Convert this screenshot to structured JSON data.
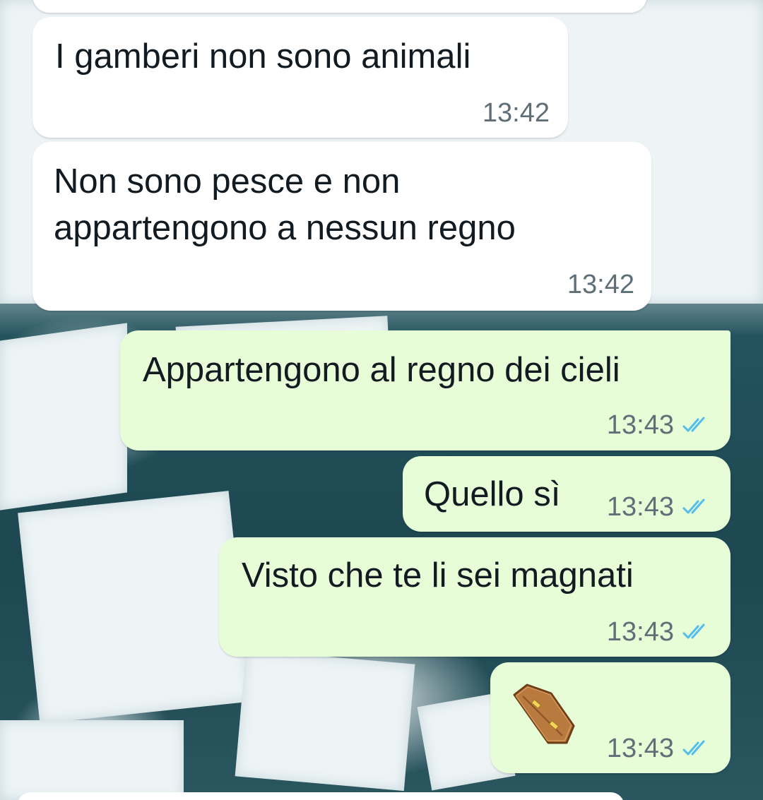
{
  "messages": [
    {
      "direction": "incoming",
      "text": "I gamberi non sono animali",
      "time": "13:42"
    },
    {
      "direction": "incoming",
      "lines": [
        "Non sono pesce e non",
        "appartengono a nessun regno"
      ],
      "time": "13:42"
    },
    {
      "direction": "outgoing",
      "text": "Appartengono al regno dei cieli",
      "time": "13:43",
      "status": "read"
    },
    {
      "direction": "outgoing",
      "text": "Quello sì",
      "time": "13:43",
      "status": "read"
    },
    {
      "direction": "outgoing",
      "text": "Visto che te li sei magnati",
      "time": "13:43",
      "status": "read"
    },
    {
      "direction": "outgoing",
      "emoji": "coffin-emoji",
      "time": "13:43",
      "status": "read"
    }
  ],
  "colors": {
    "incoming_bubble": "#ffffff",
    "outgoing_bubble": "#e7fdd8",
    "read_ticks": "#53bdeb",
    "text": "#111b21",
    "timestamp": "#5f6f78"
  }
}
